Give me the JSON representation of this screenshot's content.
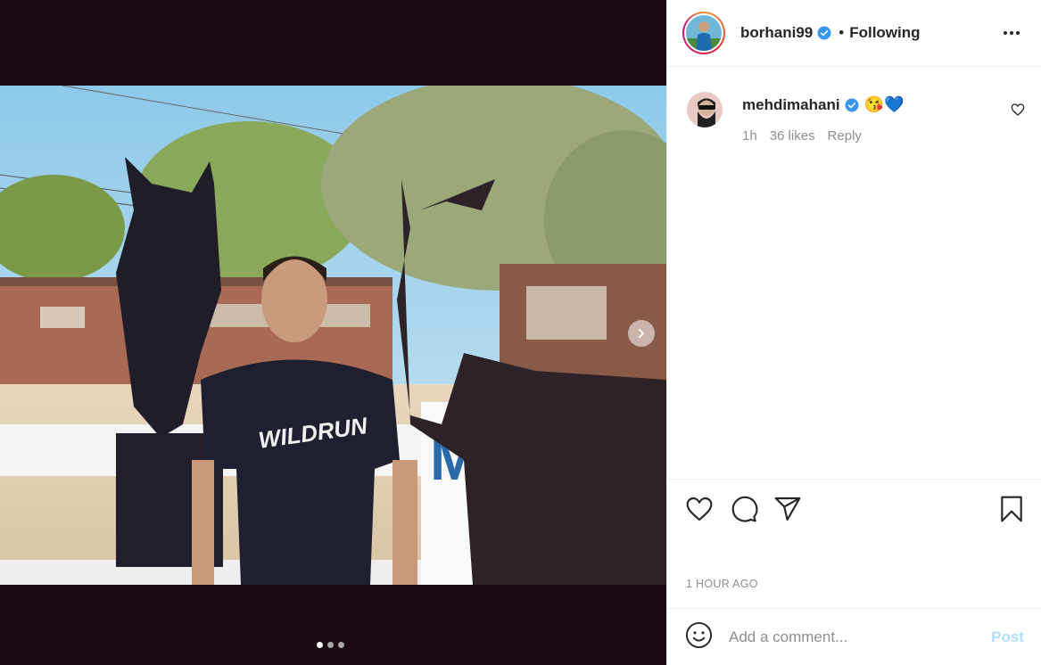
{
  "post": {
    "username": "borhani99",
    "separator": "•",
    "follow_state": "Following",
    "more_icon": "more-horizontal-icon",
    "verified_color": "#3897f0",
    "slide_count": 3,
    "active_slide": 1,
    "timestamp": "1 HOUR AGO",
    "photo_text": "M"
  },
  "comment": {
    "username": "mehdimahani",
    "emoji": "😘💙",
    "time": "1h",
    "likes": "36 likes",
    "reply": "Reply"
  },
  "actions": {
    "like_icon": "heart-icon",
    "comment_icon": "comment-icon",
    "share_icon": "paper-plane-icon",
    "save_icon": "bookmark-icon"
  },
  "add_comment": {
    "placeholder": "Add a comment...",
    "post_label": "Post",
    "emoji_icon": "smiley-icon"
  }
}
